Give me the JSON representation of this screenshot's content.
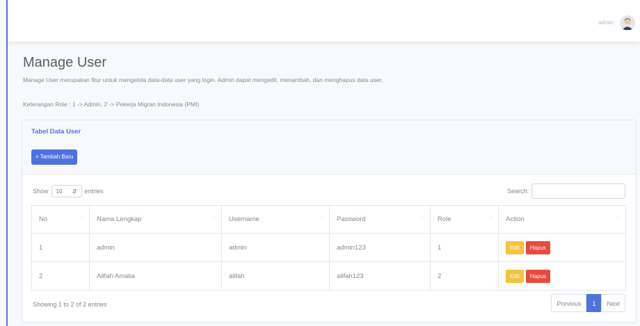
{
  "topbar": {
    "user_name": "admin"
  },
  "page": {
    "title": "Manage User",
    "description": "Manage User merupakan fitur untuk mengelola data-data user yang login. Admin dapat mengedit, menambah, dan menghapus data user.",
    "role_note": "Keterangan Role : 1 -> Admin, 2 -> Pekerja Migran Indonesia (PMI)"
  },
  "card": {
    "title": "Tabel Data User",
    "add_button": "+ Tambah Baru"
  },
  "table_controls": {
    "show_label": "Show",
    "entries_value": "10",
    "entries_label": "entries",
    "search_label": "Search:",
    "search_value": ""
  },
  "table": {
    "headers": [
      "No",
      "Nama Lengkap",
      "Username",
      "Password",
      "Role",
      "Action"
    ],
    "rows": [
      {
        "no": "1",
        "name": "admin",
        "username": "admin",
        "password": "admin123",
        "role": "1"
      },
      {
        "no": "2",
        "name": "Alifah Amalia",
        "username": "alifah",
        "password": "alifah123",
        "role": "2"
      }
    ],
    "edit_label": "Edit",
    "delete_label": "Hapus"
  },
  "footer": {
    "info": "Showing 1 to 2 of 2 entries",
    "previous": "Previous",
    "current_page": "1",
    "next": "Next"
  },
  "colors": {
    "primary": "#4e73df",
    "warning": "#f6c23e",
    "danger": "#e74a3b"
  }
}
